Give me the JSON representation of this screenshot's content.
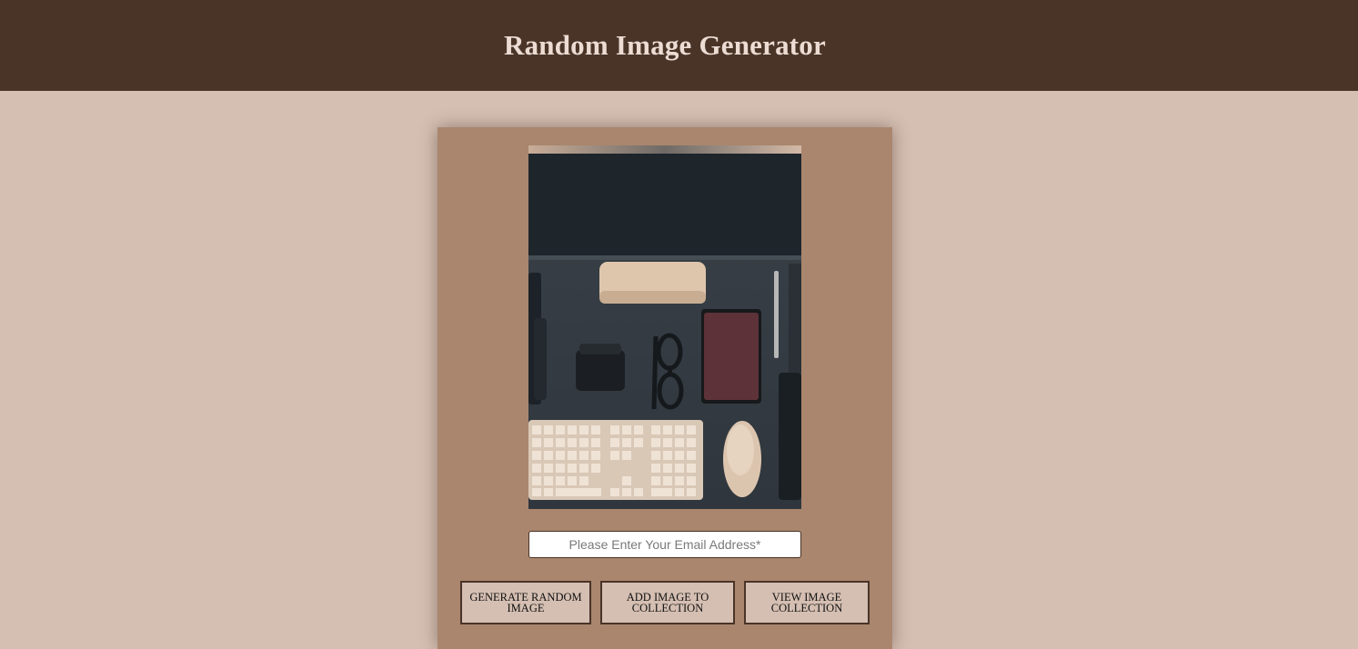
{
  "header": {
    "title": "Random Image Generator"
  },
  "main": {
    "image_alt": "Desk with keyboard, mouse, glasses and notebook",
    "email": {
      "placeholder": "Please Enter Your Email Address*",
      "value": ""
    },
    "buttons": {
      "generate": "GENERATE RANDOM IMAGE",
      "add": "ADD IMAGE TO COLLECTION",
      "view": "VIEW IMAGE COLLECTION"
    }
  },
  "colors": {
    "header_bg": "#4a3428",
    "page_bg": "#d5bfb2",
    "card_bg": "#a9866d",
    "button_bg": "#d5bfb2",
    "button_border": "#4a3428"
  }
}
